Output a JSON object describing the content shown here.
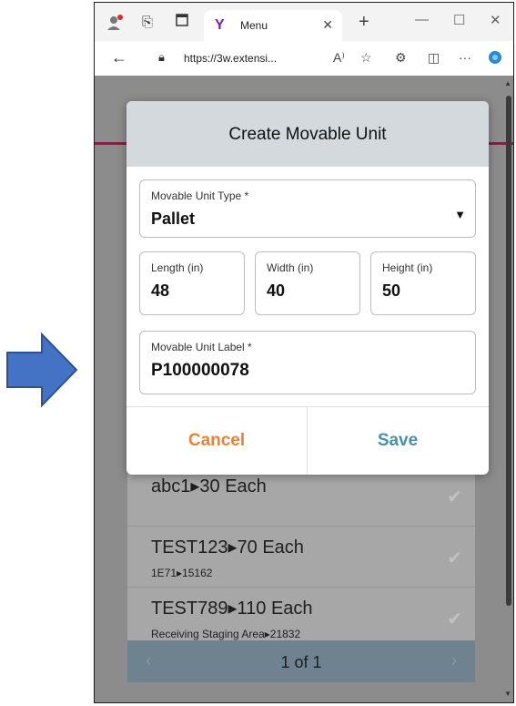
{
  "browser": {
    "tab_title": "Menu",
    "url": "https://3w.extensi..."
  },
  "modal": {
    "title": "Create Movable Unit",
    "type_field": {
      "label": "Movable Unit Type *",
      "value": "Pallet"
    },
    "length_field": {
      "label": "Length (in)",
      "value": "48"
    },
    "width_field": {
      "label": "Width (in)",
      "value": "40"
    },
    "height_field": {
      "label": "Height (in)",
      "value": "50"
    },
    "label_field": {
      "label": "Movable Unit Label *",
      "value": "P100000078"
    },
    "cancel_label": "Cancel",
    "save_label": "Save"
  },
  "list": {
    "rows": [
      {
        "title": "abc1▸30 Each",
        "sub": ""
      },
      {
        "title": "TEST123▸70 Each",
        "sub": "1E71▸15162"
      },
      {
        "title": "TEST789▸110 Each",
        "sub": "Receiving Staging Area▸21832"
      }
    ]
  },
  "pager": {
    "text": "1 of 1"
  },
  "colors": {
    "arrow": "#4472c4",
    "modal_header": "#d3d9dc",
    "cancel": "#e8833a",
    "save": "#4b90a6",
    "accent_line": "#7a2446"
  }
}
